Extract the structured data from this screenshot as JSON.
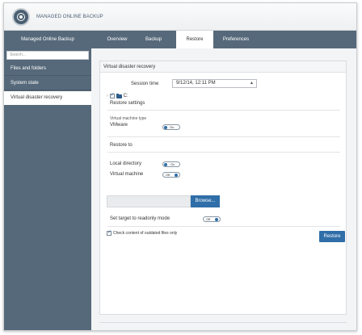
{
  "app": {
    "title": "MANAGED ONLINE BACKUP"
  },
  "nav": {
    "first": "Managed Online Backup",
    "tabs": [
      {
        "label": "Overview"
      },
      {
        "label": "Backup"
      },
      {
        "label": "Restore",
        "active": true
      },
      {
        "label": "Preferences"
      }
    ]
  },
  "sidebar": {
    "search_placeholder": "Search...",
    "items": [
      {
        "label": "Files and folders"
      },
      {
        "label": "System state"
      },
      {
        "label": "Virtual disaster recovery",
        "active": true
      }
    ]
  },
  "panel": {
    "title": "Virtual disaster recovery",
    "session_time_label": "Session time",
    "session_time_value": "9/12/14, 12:11 PM",
    "tree_item": "C:",
    "restore_settings_label": "Restore settings",
    "vm_type_label": "Virtual machine type",
    "vm_type_value": "VMware",
    "vm_toggle": "On",
    "restore_to_label": "Restore to",
    "local_directory_label": "Local directory",
    "local_directory_toggle": "On",
    "virtual_machine_label": "Virtual machine",
    "virtual_machine_toggle": "Off",
    "browse_label": "Browse...",
    "readonly_label": "Set target to readonly mode",
    "readonly_toggle": "Off",
    "outdated_label": "Check content of outdated files only",
    "restore_button": "Restore"
  },
  "colors": {
    "nav_bg": "#56697a",
    "accent_blue": "#2f6ea8",
    "panel_bg": "#ffffff"
  }
}
